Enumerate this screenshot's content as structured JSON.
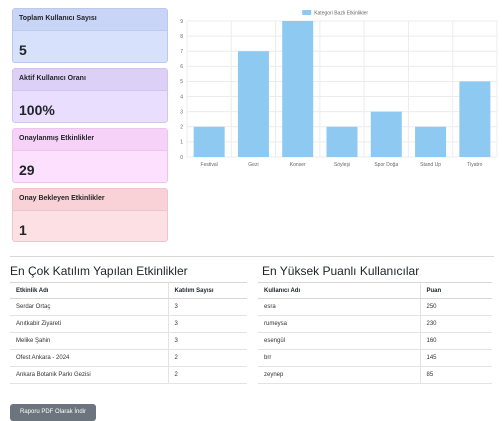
{
  "stats": [
    {
      "label": "Toplam Kullanıcı Sayısı",
      "value": "5"
    },
    {
      "label": "Aktif Kullanıcı Oranı",
      "value": "100%"
    },
    {
      "label": "Onaylanmış Etkinlikler",
      "value": "29"
    },
    {
      "label": "Onay Bekleyen Etkinlikler",
      "value": "1"
    }
  ],
  "chart_data": {
    "type": "bar",
    "categories": [
      "Festival",
      "Gezi",
      "Konser",
      "Söyleşi",
      "Spor Doğa",
      "Stand Up",
      "Tiyatro"
    ],
    "series": [
      {
        "name": "Kategori Bazlı Etkinlikler",
        "values": [
          2,
          7,
          9,
          2,
          3,
          2,
          5
        ],
        "color": "#8ec9f2"
      }
    ],
    "ylim": [
      0,
      9
    ],
    "yticks": [
      0,
      1,
      2,
      3,
      4,
      5,
      6,
      7,
      8,
      9
    ],
    "grid": true,
    "legend": "top"
  },
  "events": {
    "title": "En Çok Katılım Yapılan Etkinlikler",
    "columns": [
      "Etkinlik Adı",
      "Katılım Sayısı"
    ],
    "rows": [
      [
        "Serdar Ortaç",
        "3"
      ],
      [
        "Anıtkabir Ziyareti",
        "3"
      ],
      [
        "Melike Şahin",
        "3"
      ],
      [
        "Ofest Ankara - 2024",
        "2"
      ],
      [
        "Ankara Botanik Parkı Gezisi",
        "2"
      ]
    ]
  },
  "users": {
    "title": "En Yüksek Puanlı Kullanıcılar",
    "columns": [
      "Kullanıcı Adı",
      "Puan"
    ],
    "rows": [
      [
        "esra",
        "250"
      ],
      [
        "rumeysa",
        "230"
      ],
      [
        "esengül",
        "160"
      ],
      [
        "brr",
        "145"
      ],
      [
        "zeynep",
        "85"
      ]
    ]
  },
  "pdf_button_label": "Raporu PDF Olarak İndir"
}
